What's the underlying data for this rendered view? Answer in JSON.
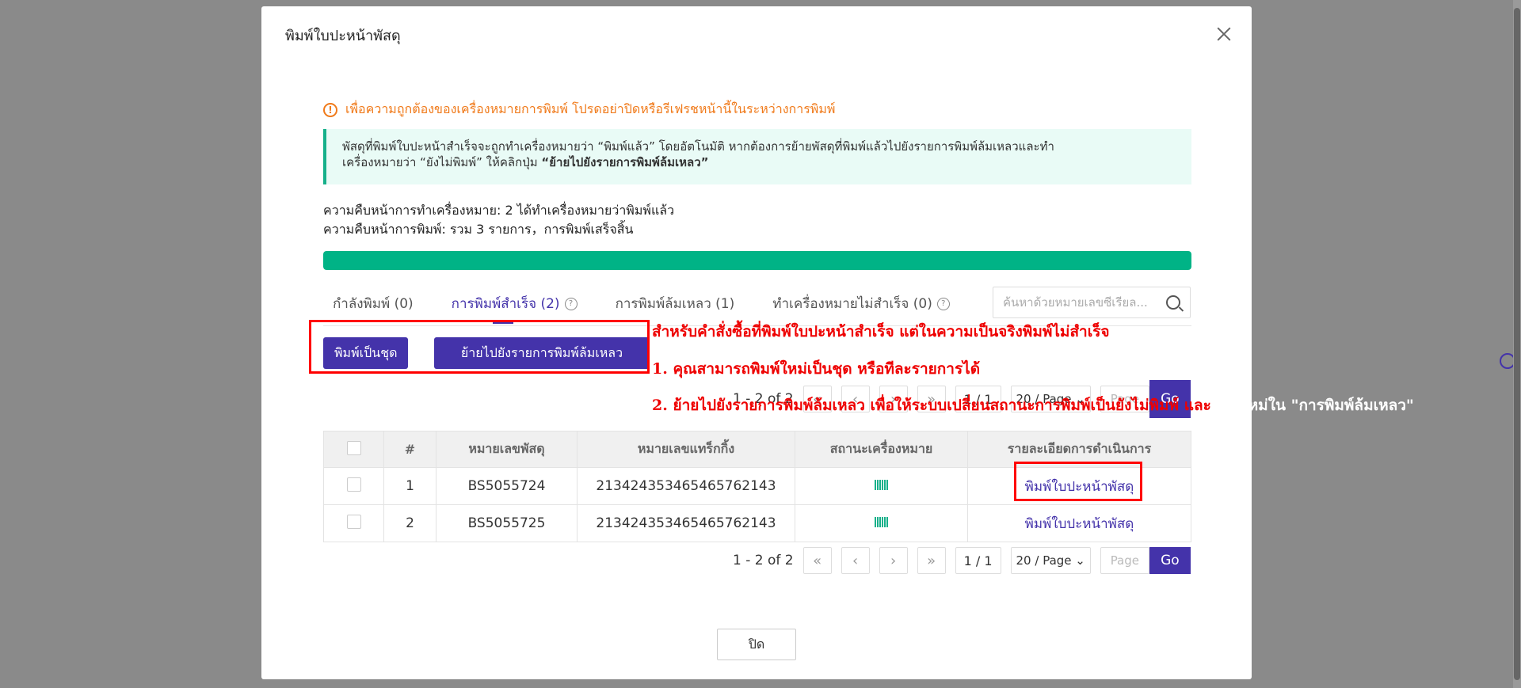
{
  "modal": {
    "title": "พิมพ์ใบปะหน้าพัสดุ"
  },
  "warning": {
    "icon": "!",
    "text": "เพื่อความถูกต้องของเครื่องหมายการพิมพ์ โปรดอย่าปิดหรือรีเฟรชหน้านี้ในระหว่างการพิมพ์"
  },
  "info": {
    "line1": "พัสดุที่พิมพ์ใบปะหน้าสำเร็จจะถูกทำเครื่องหมายว่า “พิมพ์แล้ว” โดยอัตโนมัติ หากต้องการย้ายพัสดุที่พิมพ์แล้วไปยังรายการพิมพ์ล้มเหลวและทำ",
    "line2_prefix": "เครื่องหมายว่า “ยังไม่พิมพ์” ให้คลิกปุ่ม ",
    "line2_bold": "“ย้ายไปยังรายการพิมพ์ล้มเหลว”"
  },
  "progress": {
    "marking": "ความคืบหน้าการทำเครื่องหมาย: 2 ได้ทำเครื่องหมายว่าพิมพ์แล้ว",
    "printing": "ความคืบหน้าการพิมพ์:  รวม 3 รายการ，การพิมพ์เสร็จสิ้น",
    "value": 1.0
  },
  "tabs": [
    {
      "label": "กำลังพิมพ์ (0)"
    },
    {
      "label": "การพิมพ์สำเร็จ (2)",
      "help": "?"
    },
    {
      "label": "การพิมพ์ล้มเหลว (1)"
    },
    {
      "label": "ทำเครื่องหมายไม่สำเร็จ (0)",
      "help": "?"
    }
  ],
  "search": {
    "placeholder": "ค้นหาด้วยหมายเลขซีเรียล..."
  },
  "buttons": {
    "batch_print": "พิมพ์เป็นชุด",
    "move_to_failed": "ย้ายไปยังรายการพิมพ์ล้มเหลว",
    "close": "ปิด"
  },
  "pager": {
    "range": "1 - 2 of 2",
    "page_of": "1 / 1",
    "page_size": "20 / Page",
    "page_placeholder": "Page",
    "go": "Go",
    "first": "«",
    "prev": "‹",
    "next": "›",
    "last": "»"
  },
  "table": {
    "headers": [
      "",
      "#",
      "หมายเลขพัสดุ",
      "หมายเลขแทร็กกิ้ง",
      "สถานะเครื่องหมาย",
      "รายละเอียดการดำเนินการ"
    ],
    "rows": [
      {
        "no": "1",
        "parcel": "BS5055724",
        "tracking": "213424353465465762143",
        "action": "พิมพ์ใบปะหน้าพัสดุ"
      },
      {
        "no": "2",
        "parcel": "BS5055725",
        "tracking": "213424353465465762143",
        "action": "พิมพ์ใบปะหน้าพัสดุ"
      }
    ]
  },
  "annotations": {
    "line1": "สำหรับคำสั่งซื้อที่พิมพ์ใบปะหน้าสำเร็จ แต่ในความเป็นจริงพิมพ์ไม่สำเร็จ",
    "line2": "1. คุณสามารถพิมพ์ใหม่เป็นชุด หรือทีละรายการได้",
    "line3_red": "2. ย้ายไปยังรายการพิมพ์ล้มเหลว เพื่อให้ระบบเปลี่ยนสถานะการพิมพ์เป็นยังไม่พิมพ์ และ",
    "line3_white": "พิมพ์ใหม่ใน \"การพิมพ์ล้มเหลว\""
  },
  "colors": {
    "primary": "#4433aa",
    "progress": "#00b386",
    "warning": "#f07a1a",
    "annotation": "#e00000"
  }
}
